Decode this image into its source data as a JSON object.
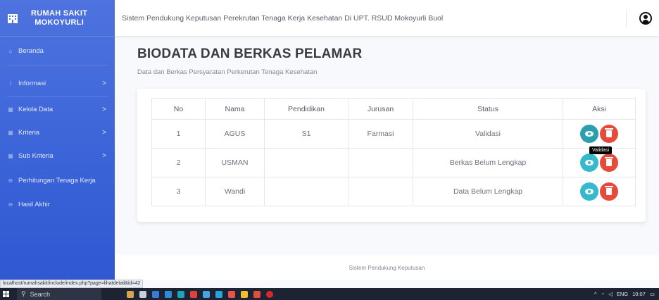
{
  "brand": {
    "line1": "RUMAH SAKIT",
    "line2": "MOKOYURLI"
  },
  "sidebar": {
    "items": [
      {
        "label": "Beranda",
        "icon": "home-icon",
        "has_chevron": false
      },
      {
        "label": "Informasi",
        "icon": "info-icon",
        "has_chevron": true
      },
      {
        "label": "Kelola Data",
        "icon": "table-icon",
        "has_chevron": true
      },
      {
        "label": "Kriteria",
        "icon": "table-icon",
        "has_chevron": true
      },
      {
        "label": "Sub Kriteria",
        "icon": "table-icon",
        "has_chevron": true
      },
      {
        "label": "Perhitungan Tenaga Kerja",
        "icon": "car-icon",
        "has_chevron": false
      },
      {
        "label": "Hasil Akhir",
        "icon": "car-icon",
        "has_chevron": false
      }
    ],
    "chevron": ">"
  },
  "topbar": {
    "title": "Sistem Pendukung Keputusan Perekrutan Tenaga Kerja Kesehatan Di UPT. RSUD Mokoyurli Buol"
  },
  "main": {
    "title": "BIODATA DAN BERKAS PELAMAR",
    "subtitle": "Data dan Berkas Persyaratan Perkerutan Tenaga Kesehatan"
  },
  "table": {
    "headers": [
      "No",
      "Nama",
      "Pendidikan",
      "Jurusan",
      "Status",
      "Aksi"
    ],
    "rows": [
      {
        "no": "1",
        "nama": "AGUS",
        "pendidikan": "S1",
        "jurusan": "Farmasi",
        "status": "Validasi"
      },
      {
        "no": "2",
        "nama": "USMAN",
        "pendidikan": "",
        "jurusan": "",
        "status": "Berkas Belum Lengkap"
      },
      {
        "no": "3",
        "nama": "Wandi",
        "pendidikan": "",
        "jurusan": "",
        "status": "Data Belum Lengkap"
      }
    ]
  },
  "tooltip": "Validasi",
  "footer": "Sistem Pendukung Keputusan",
  "browser_status_url": "localhost/rumahsakit/include/index.php?page=lihatdetail&id=42",
  "taskbar": {
    "search_placeholder": "Search",
    "tray_lang": "ENG",
    "tray_time": "10:07"
  },
  "colors": {
    "sidebar": "#4e73df",
    "info": "#36b9cc",
    "danger": "#e74a3b"
  }
}
